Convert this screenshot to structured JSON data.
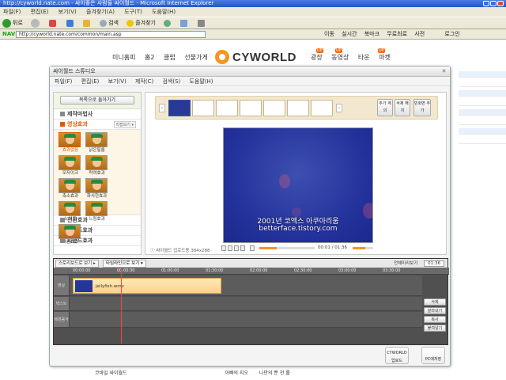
{
  "browser": {
    "title": "http://cyworld.nate.com - 싸이좋은 사람들 싸이월드 - Microsoft Internet Explorer",
    "menu": [
      "파일(F)",
      "편집(E)",
      "보기(V)",
      "즐겨찾기(A)",
      "도구(T)",
      "도움말(H)"
    ],
    "toolbar": {
      "back": "뒤로",
      "search": "검색",
      "favorites": "즐겨찾기"
    },
    "address_url": "http://cyworld.nate.com/common/main.asp",
    "naver_label": "NAVER",
    "right_buttons": [
      "이동",
      "실시간",
      "북마크",
      "무료최료",
      "사전"
    ],
    "login_label": "로그인",
    "right_tag": "연결"
  },
  "site": {
    "nav_left": [
      "미니홈피",
      "홈2",
      "클럽",
      "선물가게"
    ],
    "logo": "CYWORLD",
    "nav_right": [
      "광장",
      "동영상",
      "타운",
      "마켓"
    ],
    "up_tag": "UP"
  },
  "studio": {
    "title": "싸이월드 스튜디오",
    "menu": [
      "파일(F)",
      "편집(E)",
      "보기(V)",
      "제작(C)",
      "검색(S)",
      "도움말(H)"
    ],
    "back_button": "목록으로 돌아가기",
    "sections": {
      "make": "제작마법사",
      "effects": "영상효과",
      "effects_dropdown": "직접보기 ▾",
      "transition": "전환효과",
      "text": "텍스트효과",
      "sound": "사운드효과"
    },
    "effects": [
      "효과없음",
      "낡은필름",
      "모자이크",
      "락여효과",
      "축소효과",
      "화사한효과",
      "노이즈",
      "느림효과",
      "빠름효과"
    ],
    "strip_buttons": {
      "add": "추가 계의",
      "delete": "삭제 해지",
      "add_frame": "빈화면 추가"
    },
    "video": {
      "caption_line1": "2001년 코엑스 아쿠아리움",
      "caption_line2": "betterface.tistory.com",
      "info": "ⓘ 싸이월드 업로드용 384x288",
      "time": "00:01 / 01:36",
      "progress": 0.32,
      "volume": 0.6
    },
    "timeline": {
      "tabs": [
        "스토리보드로 보기 ▸",
        "타임라인으로 보기 ▾"
      ],
      "fullscreen_label": "전체미리보기",
      "timecode": "01:36",
      "ruler": [
        "00:00:00",
        "00:00:30",
        "01:00:00",
        "01:30:00",
        "02:00:00",
        "02:30:00",
        "03:00:00",
        "03:30:00"
      ],
      "tracks": [
        "영상",
        "텍스트",
        "배경음악"
      ],
      "clip_name": "jellyfish.wmv",
      "buttons": [
        "삭제",
        "잘라내기",
        "복사",
        "붙여넣기"
      ]
    },
    "bottom_buttons": {
      "cyworld": "CYWORLD 업로드",
      "pc": "PC에저장"
    }
  },
  "below": [
    "코바일 싸이월드",
    "아빠의 지오",
    "나만의 뿐 천 롤"
  ]
}
